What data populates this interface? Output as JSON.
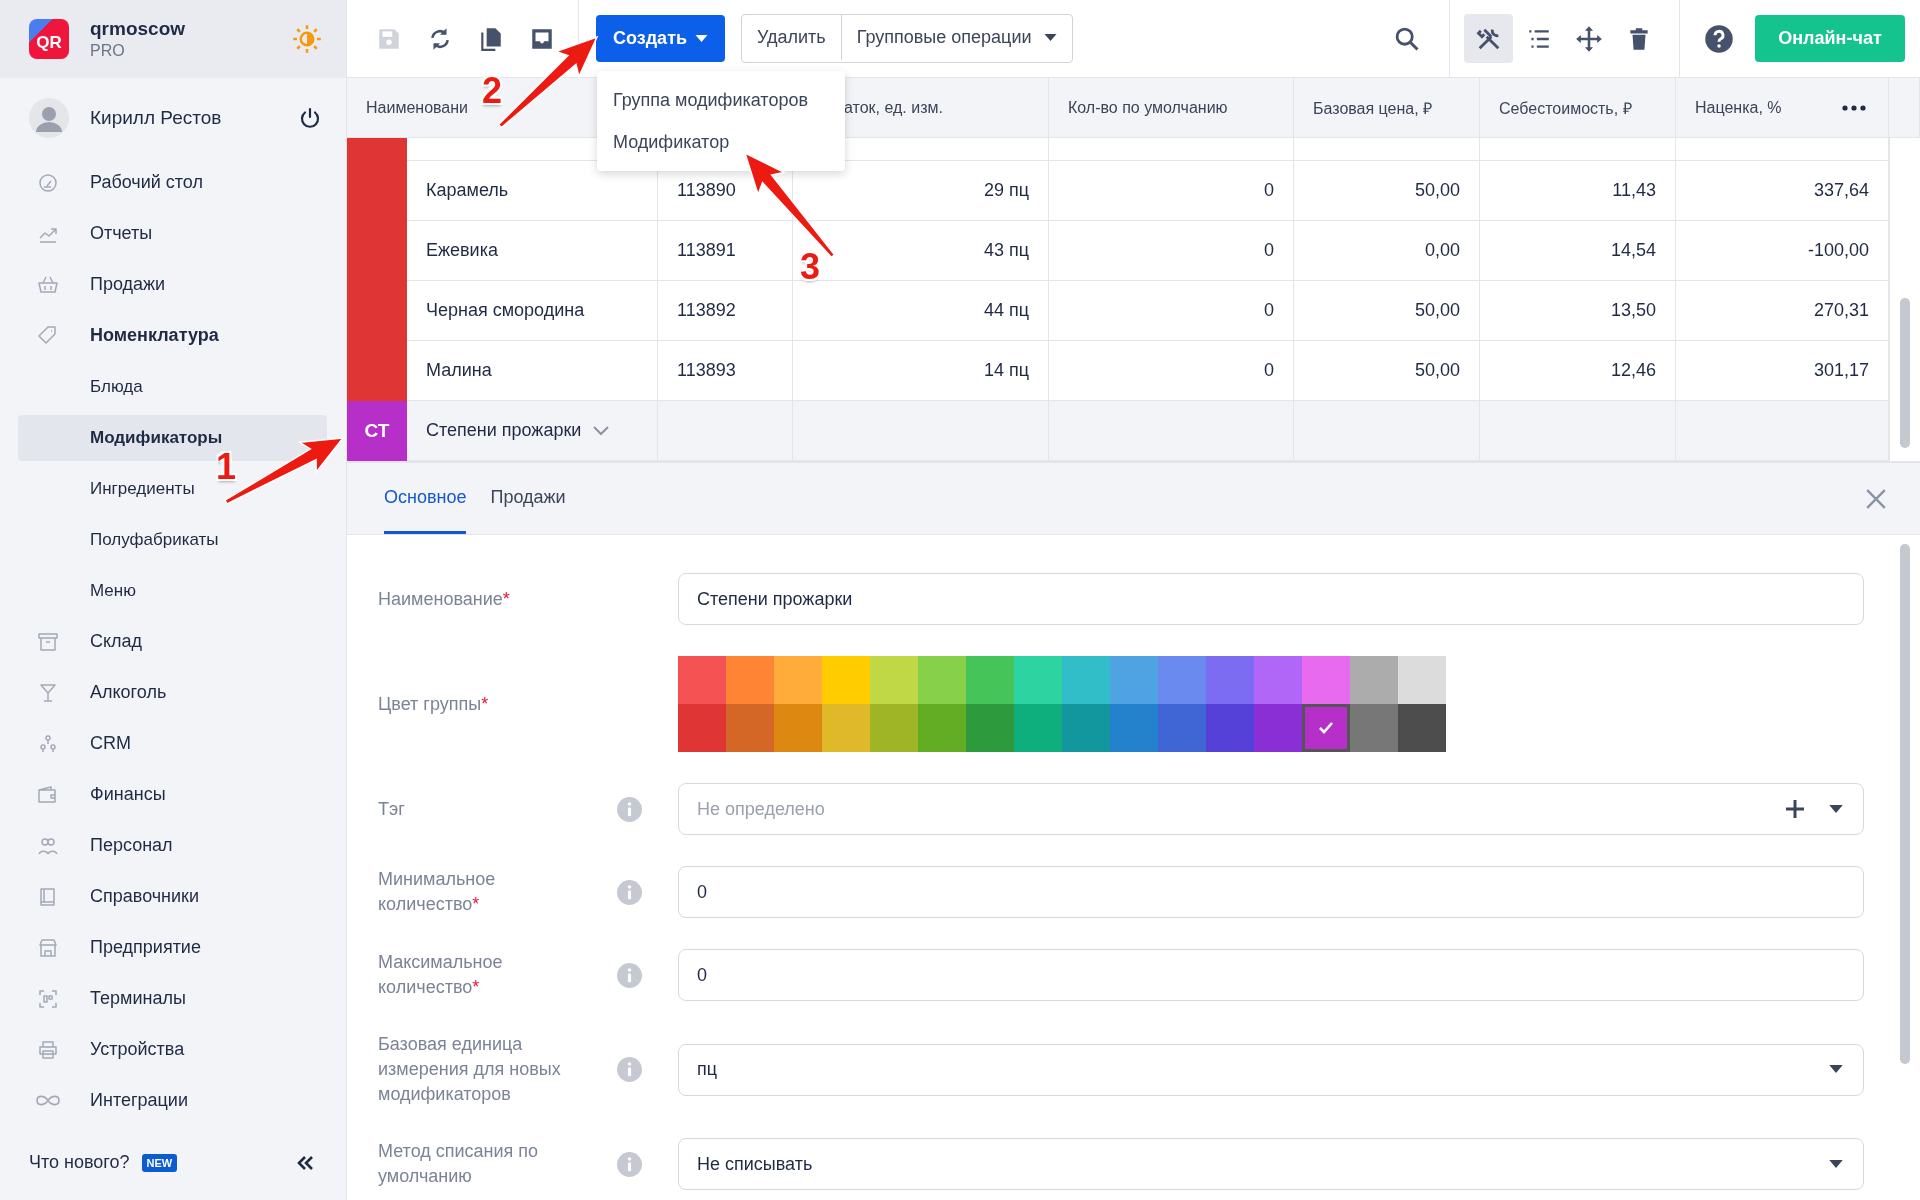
{
  "sidebar": {
    "logo_text": "QR",
    "org": {
      "name": "qrmoscow",
      "plan": "PRO"
    },
    "user": {
      "name": "Кирилл Рестов"
    },
    "nav": [
      {
        "label": "Рабочий стол",
        "expanded": false
      },
      {
        "label": "Отчеты",
        "expanded": false
      },
      {
        "label": "Продажи",
        "expanded": false
      },
      {
        "label": "Номенклатура",
        "expanded": true,
        "children": [
          {
            "label": "Блюда",
            "selected": false
          },
          {
            "label": "Модификаторы",
            "selected": true
          },
          {
            "label": "Ингредиенты",
            "selected": false
          },
          {
            "label": "Полуфабрикаты",
            "selected": false
          },
          {
            "label": "Меню",
            "selected": false
          }
        ]
      },
      {
        "label": "Склад",
        "expanded": false
      },
      {
        "label": "Алкоголь",
        "expanded": false
      },
      {
        "label": "CRM",
        "expanded": false
      },
      {
        "label": "Финансы",
        "expanded": false
      },
      {
        "label": "Персонал",
        "expanded": false
      },
      {
        "label": "Справочники",
        "expanded": false
      },
      {
        "label": "Предприятие",
        "expanded": false
      },
      {
        "label": "Терминалы",
        "expanded": false
      },
      {
        "label": "Устройства",
        "expanded": false
      },
      {
        "label": "Интеграции",
        "expanded": false
      }
    ],
    "footer": {
      "label": "Что нового?",
      "badge": "NEW"
    }
  },
  "toolbar": {
    "left_tools": [
      {
        "disabled": true
      },
      {
        "disabled": false
      },
      {
        "disabled": false
      },
      {
        "disabled": false
      }
    ],
    "create_button": {
      "label": "Создать",
      "menu": [
        "Группа модификаторов",
        "Модификатор"
      ]
    },
    "buttons": [
      "Удалить",
      "Групповые операции"
    ],
    "right_tools": [
      {
        "selected": true
      },
      {
        "selected": false
      },
      {
        "selected": false
      },
      {
        "selected": false
      }
    ],
    "chat_button": "Онлайн-чат"
  },
  "table": {
    "columns": [
      "Наименовани",
      "аток, ед. изм.",
      "Кол-во по умолчанию",
      "Базовая цена, ₽",
      "Себестоимость, ₽",
      "Наценка, %"
    ],
    "groups": [
      {
        "color": "#e03535",
        "rows": [
          {
            "name": "Карамель",
            "code": "113890",
            "stock": "29 пц",
            "default_qty": "0",
            "base_price": "50,00",
            "cost": "11,43",
            "markup": "337,64"
          },
          {
            "name": "Ежевика",
            "code": "113891",
            "stock": "43 пц",
            "default_qty": "0",
            "base_price": "0,00",
            "cost": "14,54",
            "markup": "-100,00"
          },
          {
            "name": "Черная смородина",
            "code": "113892",
            "stock": "44 пц",
            "default_qty": "0",
            "base_price": "50,00",
            "cost": "13,50",
            "markup": "270,31"
          },
          {
            "name": "Малина",
            "code": "113893",
            "stock": "14 пц",
            "default_qty": "0",
            "base_price": "50,00",
            "cost": "12,46",
            "markup": "301,17"
          }
        ]
      },
      {
        "badge": "СТ",
        "name": "Степени прожарки",
        "color": "#b62fc8",
        "expanded": false
      }
    ]
  },
  "detail_panel": {
    "tabs": [
      {
        "label": "Основное",
        "selected": true
      },
      {
        "label": "Продажи",
        "selected": false
      }
    ],
    "fields": [
      {
        "kind": "text",
        "label": "Наименование",
        "required_mark": "*",
        "info": false,
        "value": "Степени прожарки"
      },
      {
        "kind": "palette",
        "label": "Цвет группы",
        "required_mark": "*",
        "info": false,
        "swatches": [
          {
            "color": "#f55353",
            "selected": false
          },
          {
            "color": "#ff8535",
            "selected": false
          },
          {
            "color": "#ffac3a",
            "selected": false
          },
          {
            "color": "#ffcc00",
            "selected": false
          },
          {
            "color": "#c0d845",
            "selected": false
          },
          {
            "color": "#87d14a",
            "selected": false
          },
          {
            "color": "#45c45a",
            "selected": false
          },
          {
            "color": "#2dd3a0",
            "selected": false
          },
          {
            "color": "#31bec8",
            "selected": false
          },
          {
            "color": "#4fa3e3",
            "selected": false
          },
          {
            "color": "#6b8af0",
            "selected": false
          },
          {
            "color": "#7b6cf2",
            "selected": false
          },
          {
            "color": "#b066f7",
            "selected": false
          },
          {
            "color": "#e86bef",
            "selected": false
          },
          {
            "color": "#acacac",
            "selected": false
          },
          {
            "color": "#dcdcdc",
            "selected": false
          },
          {
            "color": "#e03535",
            "selected": false
          },
          {
            "color": "#d46626",
            "selected": false
          },
          {
            "color": "#dd8811",
            "selected": false
          },
          {
            "color": "#dfb929",
            "selected": false
          },
          {
            "color": "#a0b526",
            "selected": false
          },
          {
            "color": "#63ad25",
            "selected": false
          },
          {
            "color": "#2d9a3d",
            "selected": false
          },
          {
            "color": "#0fae7d",
            "selected": false
          },
          {
            "color": "#13979f",
            "selected": false
          },
          {
            "color": "#2482cc",
            "selected": false
          },
          {
            "color": "#4065d4",
            "selected": false
          },
          {
            "color": "#5641d8",
            "selected": false
          },
          {
            "color": "#8a2fd6",
            "selected": false
          },
          {
            "color": "#b62fc8",
            "selected": true
          },
          {
            "color": "#777777",
            "selected": false
          },
          {
            "color": "#4d4d4d",
            "selected": false
          }
        ]
      },
      {
        "kind": "tag",
        "label": "Тэг",
        "info": true,
        "placeholder": "Не определено"
      },
      {
        "kind": "text",
        "label": "Минимальное количество",
        "required_mark": "*",
        "info": true,
        "value": "0"
      },
      {
        "kind": "text",
        "label": "Максимальное количество",
        "required_mark": "*",
        "info": true,
        "value": "0"
      },
      {
        "kind": "select",
        "label": "Базовая единица измерения для новых модификаторов",
        "info": true,
        "value": "пц"
      },
      {
        "kind": "select",
        "label": "Метод списания по умолчанию",
        "info": true,
        "value": "Не списывать"
      }
    ]
  },
  "annotations": [
    {
      "number": "1"
    },
    {
      "number": "2"
    },
    {
      "number": "3"
    }
  ]
}
